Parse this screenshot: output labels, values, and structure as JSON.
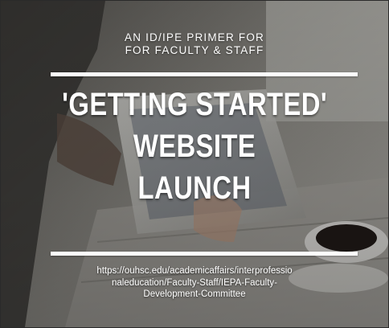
{
  "slide": {
    "subtitle_line1": "AN ID/IPE PRIMER FOR",
    "subtitle_line2": "FOR FACULTY & STAFF",
    "headline_line1": "'GETTING STARTED'",
    "headline_line2": "WEBSITE",
    "headline_line3": "LAUNCH",
    "url_line1": "https://ouhsc.edu/academicaffairs/interprofessio",
    "url_line2": "naleducation/Faculty-Staff/IEPA-Faculty-",
    "url_line3": "Development-Committee"
  },
  "colors": {
    "text": "#ffffff",
    "rule": "#ffffff",
    "background_tone": "#6b6a66"
  }
}
